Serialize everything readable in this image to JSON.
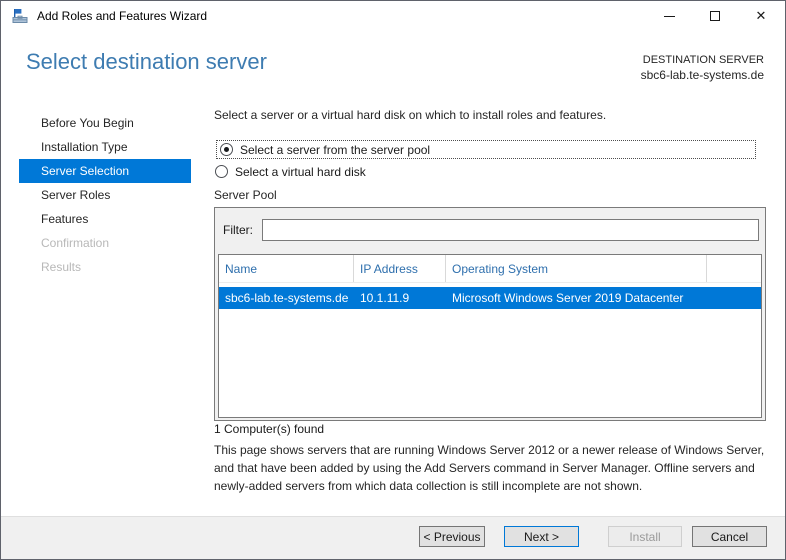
{
  "window": {
    "title": "Add Roles and Features Wizard"
  },
  "icons": {
    "close_glyph": "✕"
  },
  "header": {
    "title": "Select destination server",
    "destination_label": "DESTINATION SERVER",
    "destination_server": "sbc6-lab.te-systems.de"
  },
  "sidebar": {
    "items": [
      {
        "label": "Before You Begin",
        "state": "normal"
      },
      {
        "label": "Installation Type",
        "state": "normal"
      },
      {
        "label": "Server Selection",
        "state": "selected"
      },
      {
        "label": "Server Roles",
        "state": "normal"
      },
      {
        "label": "Features",
        "state": "normal"
      },
      {
        "label": "Confirmation",
        "state": "disabled"
      },
      {
        "label": "Results",
        "state": "disabled"
      }
    ]
  },
  "main": {
    "intro": "Select a server or a virtual hard disk on which to install roles and features.",
    "radios": [
      {
        "label": "Select a server from the server pool",
        "selected": true,
        "focused": true
      },
      {
        "label": "Select a virtual hard disk",
        "selected": false,
        "focused": false
      }
    ],
    "server_pool": {
      "label": "Server Pool",
      "filter_label": "Filter:",
      "filter_value": "",
      "table": {
        "columns": [
          "Name",
          "IP Address",
          "Operating System"
        ],
        "rows": [
          {
            "name": "sbc6-lab.te-systems.de",
            "ip": "10.1.11.9",
            "os": "Microsoft Windows Server 2019 Datacenter",
            "selected": true
          }
        ]
      }
    },
    "computers_found": "1 Computer(s) found",
    "description": "This page shows servers that are running Windows Server 2012 or a newer release of Windows Server, and that have been added by using the Add Servers command in Server Manager. Offline servers and newly-added servers from which data collection is still incomplete are not shown."
  },
  "footer": {
    "buttons": [
      {
        "label": "< Previous",
        "state": "normal"
      },
      {
        "label": "Next >",
        "state": "default"
      },
      {
        "label": "Install",
        "state": "disabled"
      },
      {
        "label": "Cancel",
        "state": "normal"
      }
    ]
  },
  "colors": {
    "accent": "#0078d7",
    "header_title_blue": "#3e7cb1",
    "table_header_text": "#2e6fad",
    "disabled_text": "#b8b8b8"
  }
}
